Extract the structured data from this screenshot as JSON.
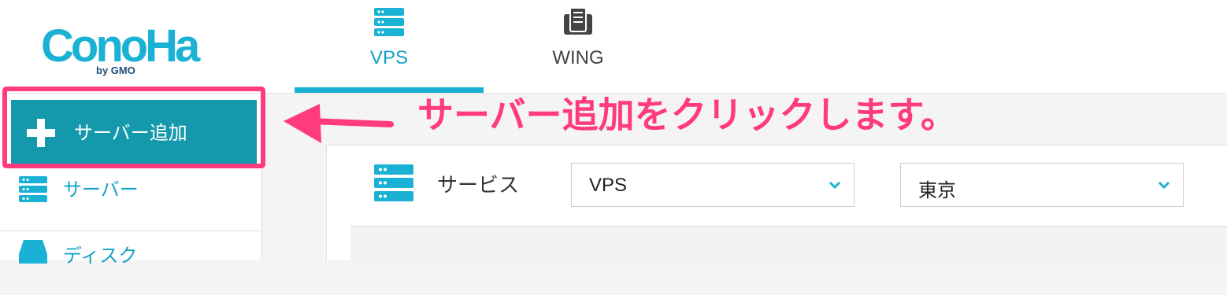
{
  "header": {
    "logo_text": "ConoHa",
    "logo_sub": "by GMO",
    "tabs": [
      {
        "label": "VPS",
        "icon": "server-stack-icon",
        "active": true
      },
      {
        "label": "WING",
        "icon": "wing-icon",
        "active": false
      }
    ]
  },
  "sidebar": {
    "add_server_label": "サーバー追加",
    "items": [
      {
        "label": "サーバー",
        "icon": "server-stack-icon"
      },
      {
        "label": "ディスク",
        "icon": "disk-icon"
      }
    ]
  },
  "main": {
    "service_label": "サービス",
    "service_select": {
      "value": "VPS"
    },
    "region_select": {
      "value": "東京"
    }
  },
  "annotation": {
    "text": "サーバー追加をクリックします。"
  },
  "colors": {
    "accent": "#1ab2d4",
    "add_button_bg": "#1498ac",
    "highlight": "#ff3a7f"
  }
}
